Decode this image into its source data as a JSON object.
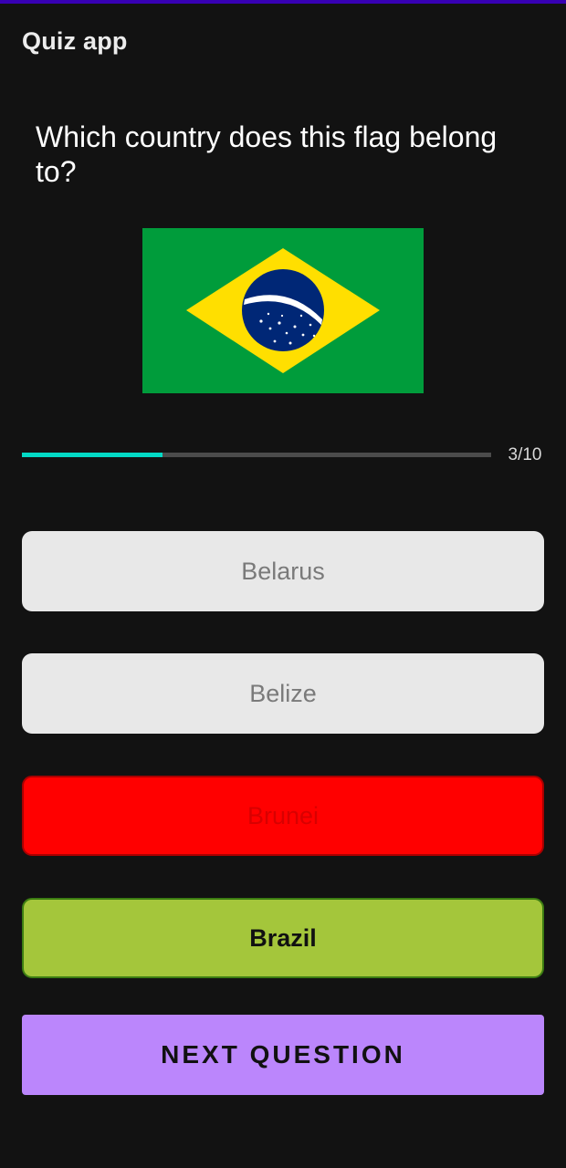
{
  "app_bar": {
    "title": "Quiz app",
    "accent_color": "#3700b3"
  },
  "question": {
    "text": "Which country does this flag belong to?",
    "flag": "brazil-flag"
  },
  "progress": {
    "current": 3,
    "total": 10,
    "fraction": 0.3,
    "label": "3/10",
    "color": "#03dac5"
  },
  "options": [
    {
      "label": "Belarus",
      "state": "unselected",
      "color": "#e8e8e8"
    },
    {
      "label": "Belize",
      "state": "unselected",
      "color": "#e8e8e8"
    },
    {
      "label": "Brunei",
      "state": "wrong",
      "color": "#ff0000"
    },
    {
      "label": "Brazil",
      "state": "correct",
      "color": "#a4c63b"
    }
  ],
  "next_button": {
    "label": "NEXT QUESTION",
    "color": "#bb86fc"
  }
}
